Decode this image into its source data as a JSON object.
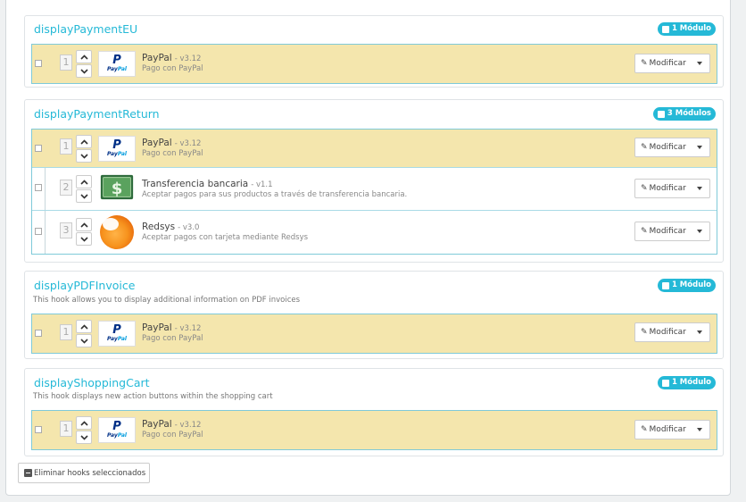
{
  "hooks": [
    {
      "title": "displayPaymentEU",
      "description": "",
      "badge": "1 Módulo",
      "modules": [
        {
          "position": "1",
          "name": "PayPal",
          "version": "- v3.12",
          "description": "Pago con PayPal",
          "logo": "paypal-logo",
          "highlighted": true
        }
      ]
    },
    {
      "title": "displayPaymentReturn",
      "description": "",
      "badge": "3 Módulos",
      "modules": [
        {
          "position": "1",
          "name": "PayPal",
          "version": "- v3.12",
          "description": "Pago con PayPal",
          "logo": "paypal-logo",
          "highlighted": true
        },
        {
          "position": "2",
          "name": "Transferencia bancaria",
          "version": "- v1.1",
          "description": "Aceptar pagos para sus productos a través de transferencia bancaria.",
          "logo": "bank-transfer-logo",
          "highlighted": false
        },
        {
          "position": "3",
          "name": "Redsys",
          "version": "- v3.0",
          "description": "Aceptar pagos con tarjeta mediante Redsys",
          "logo": "redsys-logo",
          "highlighted": false
        }
      ]
    },
    {
      "title": "displayPDFInvoice",
      "description": "This hook allows you to display additional information on PDF invoices",
      "badge": "1 Módulo",
      "modules": [
        {
          "position": "1",
          "name": "PayPal",
          "version": "- v3.12",
          "description": "Pago con PayPal",
          "logo": "paypal-logo",
          "highlighted": true
        }
      ]
    },
    {
      "title": "displayShoppingCart",
      "description": "This hook displays new action buttons within the shopping cart",
      "badge": "1 Módulo",
      "modules": [
        {
          "position": "1",
          "name": "PayPal",
          "version": "- v3.12",
          "description": "Pago con PayPal",
          "logo": "paypal-logo",
          "highlighted": true
        }
      ]
    }
  ],
  "paypal_logo_text": {
    "pay": "Pay",
    "pal": "Pal"
  },
  "modify_label": "Modificar",
  "delete_selected_label": "Eliminar hooks seleccionados",
  "colors": {
    "accent": "#25b9d7",
    "highlight_row": "#f4e6ad",
    "page_bg": "#eff1f2"
  }
}
